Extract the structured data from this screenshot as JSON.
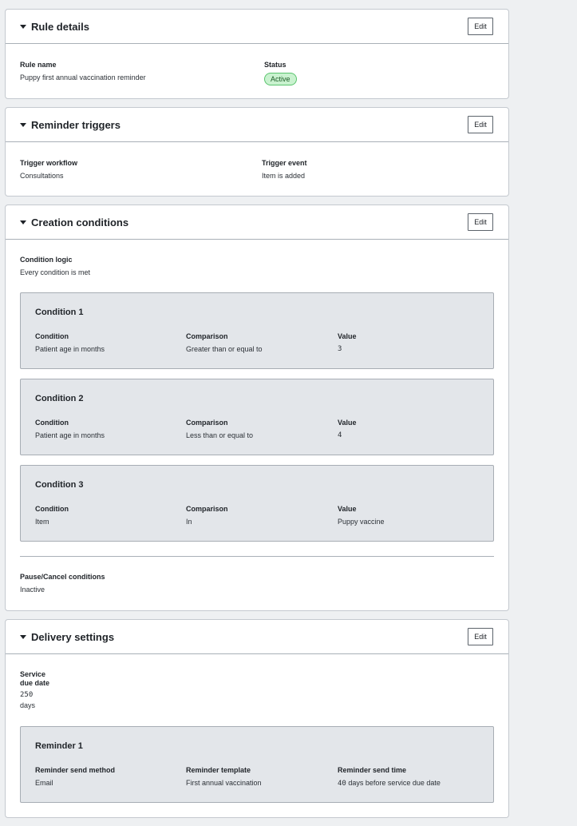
{
  "edit_label": "Edit",
  "rule_details": {
    "title": "Rule details",
    "rule_name_label": "Rule name",
    "rule_name_value": "Puppy first annual vaccination reminder",
    "status_label": "Status",
    "status_value": "Active"
  },
  "reminder_triggers": {
    "title": "Reminder triggers",
    "workflow_label": "Trigger workflow",
    "workflow_value": "Consultations",
    "event_label": "Trigger event",
    "event_value": "Item is added"
  },
  "creation_conditions": {
    "title": "Creation conditions",
    "logic_label": "Condition logic",
    "logic_value": "Every condition is met",
    "col_condition": "Condition",
    "col_comparison": "Comparison",
    "col_value": "Value",
    "conditions": [
      {
        "title": "Condition 1",
        "condition": "Patient age in months",
        "comparison": "Greater than or equal to",
        "value": "3"
      },
      {
        "title": "Condition 2",
        "condition": "Patient age in months",
        "comparison": "Less than or equal to",
        "value": "4"
      },
      {
        "title": "Condition 3",
        "condition": "Item",
        "comparison": "In",
        "value": "Puppy vaccine"
      }
    ],
    "pause_label": "Pause/Cancel conditions",
    "pause_value": "Inactive"
  },
  "delivery_settings": {
    "title": "Delivery settings",
    "due_label_line1": "Service",
    "due_label_line2": "due date",
    "due_value": "250",
    "due_unit": "days",
    "reminder": {
      "title": "Reminder 1",
      "method_label": "Reminder send method",
      "method_value": "Email",
      "template_label": "Reminder template",
      "template_value": "First annual vaccination",
      "time_label": "Reminder send time",
      "time_number": "40",
      "time_rest": " days before service due date"
    }
  },
  "colors": {
    "badge_bg": "#c9f2cf",
    "badge_border": "#5ac46e",
    "card_bg": "#e3e6ea",
    "page_bg": "#eef0f2"
  }
}
